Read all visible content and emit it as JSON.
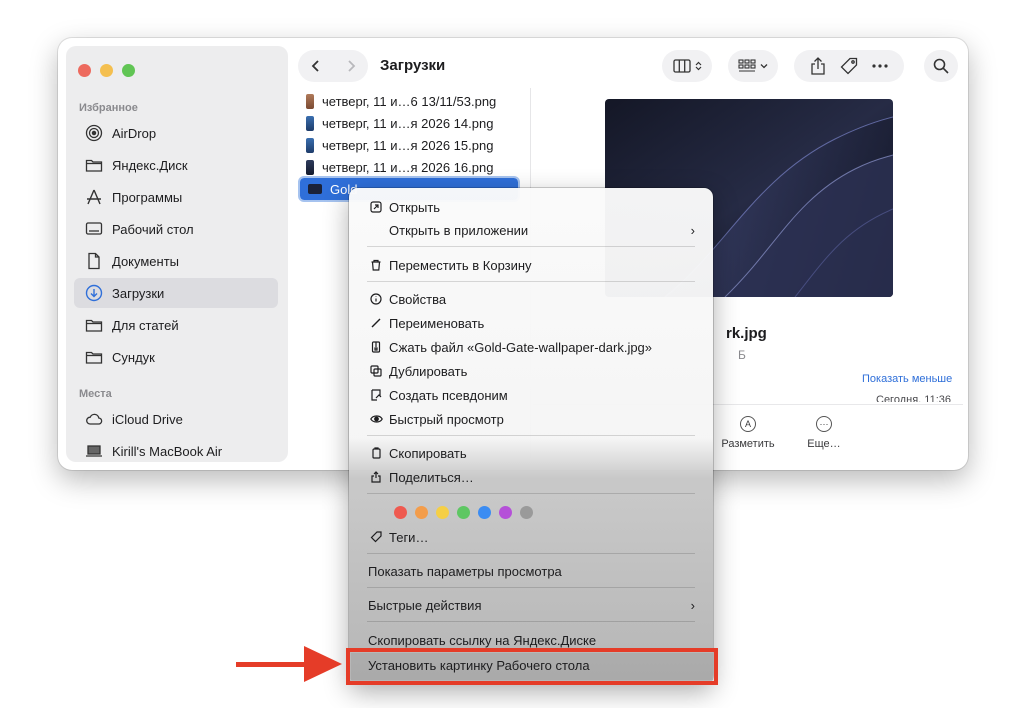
{
  "window": {
    "title": "Загрузки"
  },
  "sidebar": {
    "favorites_header": "Избранное",
    "places_header": "Места",
    "favorites": [
      {
        "label": "AirDrop",
        "icon": "airdrop-icon"
      },
      {
        "label": "Яндекс.Диск",
        "icon": "folder-icon"
      },
      {
        "label": "Программы",
        "icon": "applications-icon"
      },
      {
        "label": "Рабочий стол",
        "icon": "desktop-icon"
      },
      {
        "label": "Документы",
        "icon": "document-icon"
      },
      {
        "label": "Загрузки",
        "icon": "downloads-icon",
        "active": true
      },
      {
        "label": "Для статей",
        "icon": "folder-icon"
      },
      {
        "label": "Сундук",
        "icon": "folder-icon"
      }
    ],
    "places": [
      {
        "label": "iCloud Drive",
        "icon": "cloud-icon"
      },
      {
        "label": "Kirill's MacBook Air",
        "icon": "laptop-icon"
      }
    ]
  },
  "files": [
    {
      "name": "четверг, 11 и…6 13/11/53.png"
    },
    {
      "name": "четверг, 11 и…я 2026 14.png"
    },
    {
      "name": "четверг, 11 и…я 2026 15.png"
    },
    {
      "name": "четверг, 11 и…я 2026 16.png"
    },
    {
      "name": "Gold",
      "selected": true
    }
  ],
  "preview": {
    "filename_tail": "rk.jpg",
    "size_tail": "Б",
    "show_less": "Показать меньше",
    "date": "Сегодня, 11:36",
    "actions": [
      {
        "label": "Разметить",
        "icon": "markup-icon"
      },
      {
        "label": "Еще…",
        "icon": "more-icon"
      }
    ]
  },
  "context_menu": {
    "open": "Открыть",
    "open_with": "Открыть в приложении",
    "trash": "Переместить в Корзину",
    "info": "Свойства",
    "rename": "Переименовать",
    "compress": "Сжать файл «Gold-Gate-wallpaper-dark.jpg»",
    "duplicate": "Дублировать",
    "alias": "Создать псевдоним",
    "quicklook": "Быстрый просмотр",
    "copy": "Скопировать",
    "share": "Поделиться…",
    "tag_colors": [
      "#ef5a50",
      "#f39d4b",
      "#f5cf46",
      "#5ec763",
      "#3b8cf2",
      "#b550d8",
      "#9a9a9a"
    ],
    "tags": "Теги…",
    "view_options": "Показать параметры просмотра",
    "quick_actions": "Быстрые действия",
    "copy_yadisk": "Скопировать ссылку на Яндекс.Диске",
    "set_wallpaper": "Установить картинку Рабочего стола"
  },
  "annotation": {
    "color": "#e53c28"
  }
}
